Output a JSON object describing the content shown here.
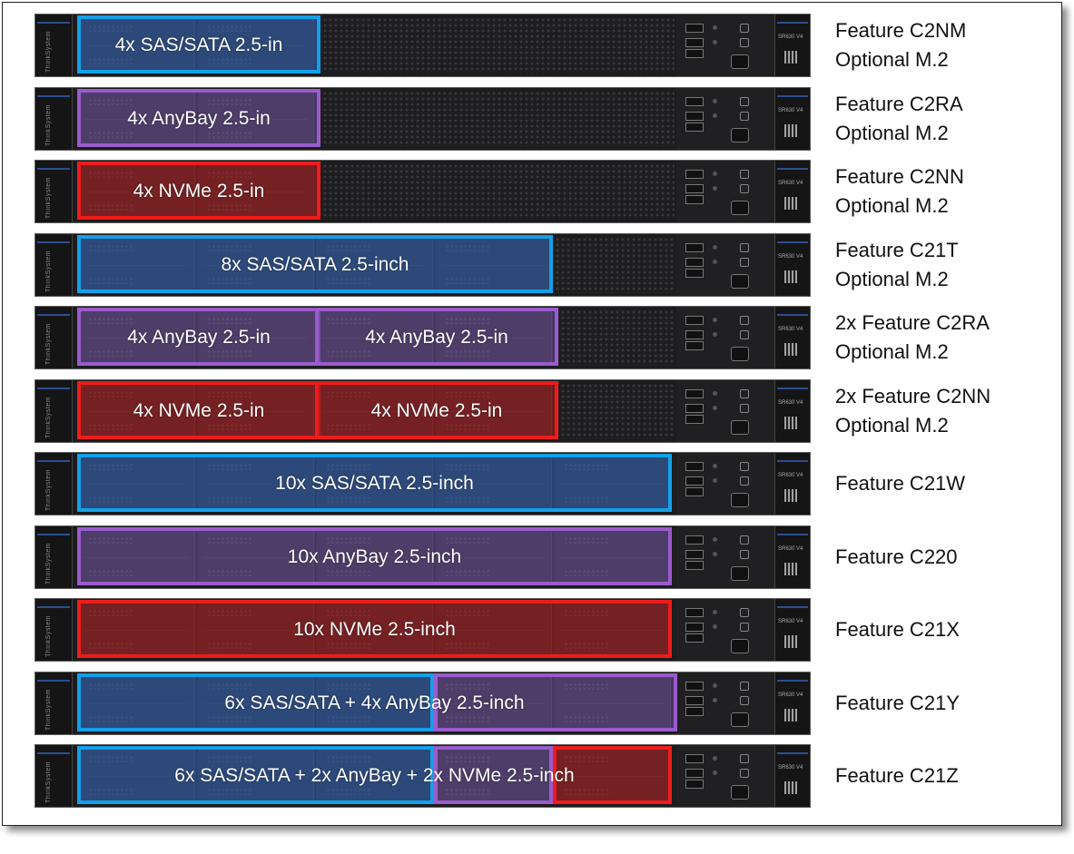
{
  "rows": [
    {
      "server_model": "SR630 V4",
      "brand": "ThinkSystem",
      "bays": 4,
      "layout": "4bay",
      "segments": [
        {
          "type": "sas",
          "bays": 4,
          "label": "4x SAS/SATA 2.5-in"
        }
      ],
      "feature": [
        "Feature C2NM",
        "Optional M.2"
      ]
    },
    {
      "server_model": "SR630 V4",
      "brand": "ThinkSystem",
      "bays": 4,
      "layout": "4bay",
      "segments": [
        {
          "type": "any",
          "bays": 4,
          "label": "4x AnyBay 2.5-in"
        }
      ],
      "feature": [
        "Feature C2RA",
        "Optional M.2"
      ]
    },
    {
      "server_model": "SR630 V4",
      "brand": "ThinkSystem",
      "bays": 4,
      "layout": "4bay",
      "segments": [
        {
          "type": "nvme",
          "bays": 4,
          "label": "4x NVMe 2.5-in"
        }
      ],
      "feature": [
        "Feature C2NN",
        "Optional M.2"
      ]
    },
    {
      "server_model": "SR630 V4",
      "brand": "ThinkSystem",
      "bays": 8,
      "layout": "8bay",
      "segments": [
        {
          "type": "sas",
          "bays": 8,
          "label": "8x SAS/SATA 2.5-inch"
        }
      ],
      "feature": [
        "Feature C21T",
        "Optional M.2"
      ]
    },
    {
      "server_model": "SR630 V4",
      "brand": "ThinkSystem",
      "bays": 8,
      "layout": "8bay",
      "segments": [
        {
          "type": "any",
          "bays": 4,
          "label": "4x AnyBay 2.5-in"
        },
        {
          "type": "any",
          "bays": 4,
          "label": "4x AnyBay 2.5-in"
        }
      ],
      "feature": [
        "2x Feature C2RA",
        "Optional M.2"
      ]
    },
    {
      "server_model": "SR630 V4",
      "brand": "ThinkSystem",
      "bays": 8,
      "layout": "8bay",
      "segments": [
        {
          "type": "nvme",
          "bays": 4,
          "label": "4x NVMe 2.5-in"
        },
        {
          "type": "nvme",
          "bays": 4,
          "label": "4x NVMe 2.5-in"
        }
      ],
      "feature": [
        "2x Feature C2NN",
        "Optional M.2"
      ]
    },
    {
      "server_model": "SR630 V4",
      "brand": "ThinkSystem",
      "bays": 10,
      "layout": "10bay",
      "segments": [
        {
          "type": "sas",
          "bays": 10,
          "label": "10x SAS/SATA 2.5-inch"
        }
      ],
      "feature": [
        "Feature C21W"
      ]
    },
    {
      "server_model": "SR630 V4",
      "brand": "ThinkSystem",
      "bays": 10,
      "layout": "10bay",
      "segments": [
        {
          "type": "any",
          "bays": 10,
          "label": "10x AnyBay 2.5-inch"
        }
      ],
      "feature": [
        "Feature C220"
      ]
    },
    {
      "server_model": "SR630 V4",
      "brand": "ThinkSystem",
      "bays": 10,
      "layout": "10bay",
      "segments": [
        {
          "type": "nvme",
          "bays": 10,
          "label": "10x NVMe 2.5-inch"
        }
      ],
      "feature": [
        "Feature C21X"
      ]
    },
    {
      "server_model": "SR630 V4",
      "brand": "ThinkSystem",
      "bays": 10,
      "layout": "10bay",
      "segments": [
        {
          "type": "sas",
          "bays": 6,
          "label": ""
        },
        {
          "type": "any",
          "bays": 4,
          "label": ""
        }
      ],
      "row_label": "6x SAS/SATA + 4x AnyBay 2.5-inch",
      "feature": [
        "Feature C21Y"
      ]
    },
    {
      "server_model": "SR630 V4",
      "brand": "ThinkSystem",
      "bays": 10,
      "layout": "10bay",
      "segments": [
        {
          "type": "sas",
          "bays": 6,
          "label": ""
        },
        {
          "type": "any",
          "bays": 2,
          "label": ""
        },
        {
          "type": "nvme",
          "bays": 2,
          "label": ""
        }
      ],
      "row_label": "6x SAS/SATA + 2x AnyBay + 2x NVMe 2.5-inch",
      "feature": [
        "Feature C21Z"
      ]
    }
  ],
  "colors": {
    "sas": "#14a0e8",
    "any": "#9a5bcc",
    "nvme": "#ee1c1c"
  }
}
